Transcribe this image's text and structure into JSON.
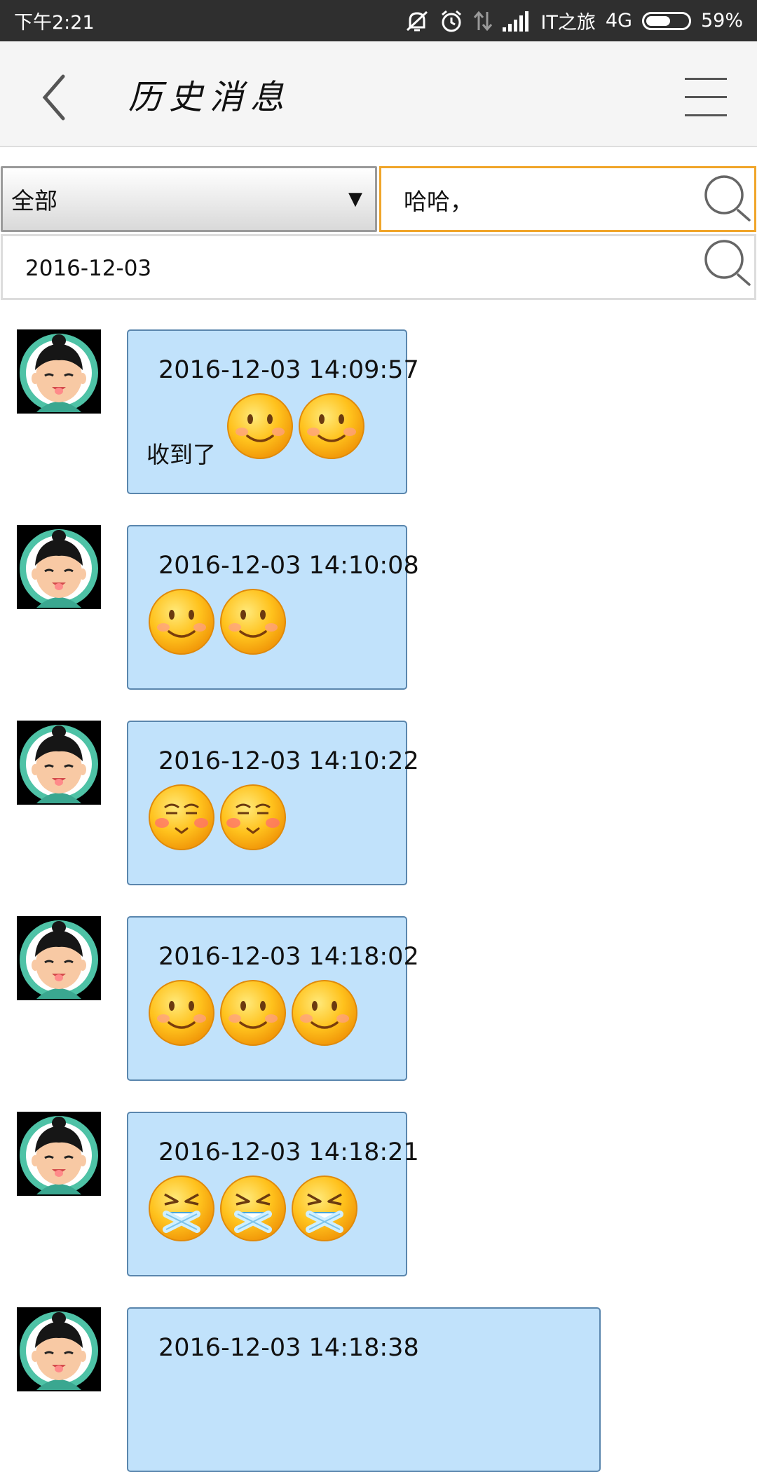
{
  "status_bar": {
    "time": "下午2:21",
    "carrier": "IT之旅",
    "network": "4G",
    "battery_percent": "59%",
    "battery_level": 0.59,
    "icons": [
      "mute-icon",
      "alarm-icon",
      "data-arrows-icon",
      "signal-icon"
    ]
  },
  "header": {
    "title": "历史消息",
    "back_icon": "chevron-left-icon",
    "menu_icon": "hamburger-menu-icon"
  },
  "filters": {
    "category_value": "全部",
    "keyword_value": "哈哈，",
    "date_value": "2016-12-03",
    "accent_color": "#f0a52a"
  },
  "messages": [
    {
      "time": "2016-12-03 14:09:57",
      "text": "收到了",
      "emojis": [
        "smile",
        "smile"
      ]
    },
    {
      "time": "2016-12-03 14:10:08",
      "text": "",
      "emojis": [
        "smile",
        "smile"
      ]
    },
    {
      "time": "2016-12-03 14:10:22",
      "text": "",
      "emojis": [
        "shy",
        "shy"
      ]
    },
    {
      "time": "2016-12-03 14:18:02",
      "text": "",
      "emojis": [
        "smile",
        "smile",
        "smile"
      ]
    },
    {
      "time": "2016-12-03 14:18:21",
      "text": "",
      "emojis": [
        "sealed",
        "sealed",
        "sealed"
      ]
    },
    {
      "time": "2016-12-03 14:18:38",
      "text": "",
      "emojis": []
    }
  ],
  "colors": {
    "bubble_fill": "#c1e2fb",
    "bubble_border": "#5a86ad",
    "avatar_ring": "#4ec2a6"
  }
}
